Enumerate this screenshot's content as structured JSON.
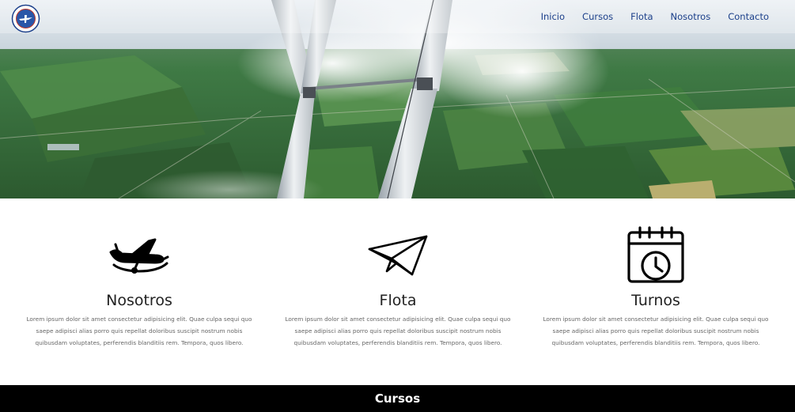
{
  "nav": {
    "items": [
      "Inicio",
      "Cursos",
      "Flota",
      "Nosotros",
      "Contacto"
    ]
  },
  "logo": {
    "icon": "school-seal-logo",
    "colors": [
      "#1b3f8a",
      "#c0392b"
    ]
  },
  "features": [
    {
      "icon": "airplane-icon",
      "title": "Nosotros",
      "text": "Lorem ipsum dolor sit amet consectetur adipisicing elit. Quae culpa sequi quo saepe adipisci alias porro quis repellat doloribus suscipit nostrum nobis quibusdam voluptates, perferendis blanditiis rem. Tempora, quos libero."
    },
    {
      "icon": "paper-plane-icon",
      "title": "Flota",
      "text": "Lorem ipsum dolor sit amet consectetur adipisicing elit. Quae culpa sequi quo saepe adipisci alias porro quis repellat doloribus suscipit nostrum nobis quibusdam voluptates, perferendis blanditiis rem. Tempora, quos libero."
    },
    {
      "icon": "calendar-clock-icon",
      "title": "Turnos",
      "text": "Lorem ipsum dolor sit amet consectetur adipisicing elit. Quae culpa sequi quo saepe adipisci alias porro quis repellat doloribus suscipit nostrum nobis quibusdam voluptates, perferendis blanditiis rem. Tempora, quos libero."
    }
  ],
  "section": {
    "title": "Cursos"
  },
  "colors": {
    "nav_link": "#1b3f8a",
    "bar_bg": "#000000",
    "bar_text": "#ffffff"
  }
}
